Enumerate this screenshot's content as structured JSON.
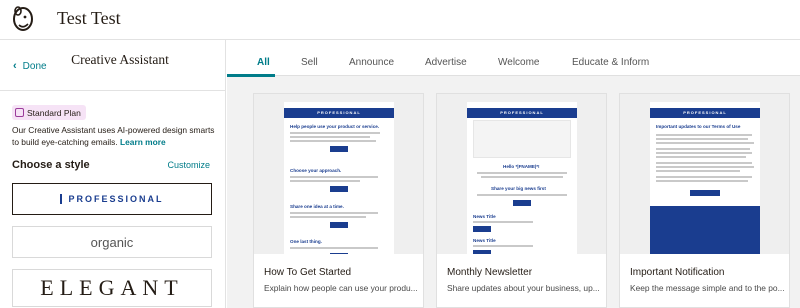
{
  "app": {
    "title": "Test Test"
  },
  "sidebar": {
    "done_label": "Done",
    "title": "Creative Assistant",
    "badge_label": "Standard Plan",
    "description": "Our Creative Assistant uses AI-powered design smarts to build eye-catching emails.",
    "learn_more": "Learn more",
    "choose_label": "Choose a style",
    "customize_label": "Customize",
    "styles": [
      {
        "label": "PROFESSIONAL",
        "selected": true
      },
      {
        "label": "organic",
        "selected": false
      },
      {
        "label": "ELEGANT",
        "selected": false
      }
    ]
  },
  "tabs": [
    "All",
    "Sell",
    "Announce",
    "Advertise",
    "Welcome",
    "Educate & Inform"
  ],
  "active_tab": "All",
  "cards": [
    {
      "title": "How To Get Started",
      "description": "Explain how people can use your produ...",
      "preview": {
        "bar_label": "PROFESSIONAL",
        "headings": [
          "Help people use your product or service.",
          "Choose your approach.",
          "Share one idea at a time.",
          "One last thing."
        ]
      }
    },
    {
      "title": "Monthly Newsletter",
      "description": "Share updates about your business, up...",
      "preview": {
        "bar_label": "PROFESSIONAL",
        "headings": [
          "Hello *|FNAME|*!",
          "Share your big news first",
          "News Title",
          "News Title"
        ]
      }
    },
    {
      "title": "Important Notification",
      "description": "Keep the message simple and to the po...",
      "preview": {
        "bar_label": "PROFESSIONAL",
        "headings": [
          "Important updates to our Terms of Use"
        ]
      }
    }
  ],
  "colors": {
    "accent": "#007c89",
    "brand_blue": "#1a3d8f",
    "badge_bg": "#f6e3f6"
  }
}
